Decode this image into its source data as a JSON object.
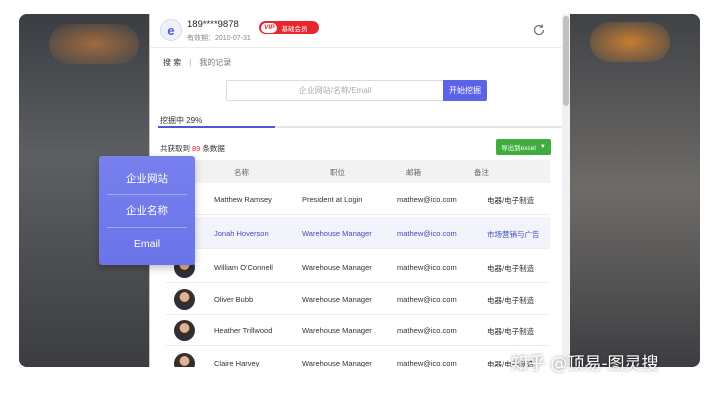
{
  "header": {
    "phone": "189****9878",
    "expiry": "有效期：2010-07-31",
    "vip_tag": "VIP",
    "vip_label": "基础会员"
  },
  "subnav": {
    "search": "搜 索",
    "separator": "|",
    "records": "我的记录"
  },
  "search": {
    "placeholder": "企业网站/名称/Email",
    "button": "开始挖掘"
  },
  "progress": {
    "label": "挖掘中 29%",
    "fraction": 0.29
  },
  "results": {
    "count_prefix": "共获取到",
    "count": "89",
    "count_suffix": "条数据",
    "export_label": "导出到excel"
  },
  "table": {
    "headers": [
      "名称",
      "职位",
      "邮箱",
      "备注"
    ],
    "rows": [
      {
        "name": "Matthew Ramsey",
        "title": "President at Login",
        "email": "mathew@ico.com",
        "note": "电器/电子制造"
      },
      {
        "name": "Jonah Hoverson",
        "title": "Warehouse Manager",
        "email": "mathew@ico.com",
        "note": "市场营销与广告"
      },
      {
        "name": "William O'Connell",
        "title": "Warehouse Manager",
        "email": "mathew@ico.com",
        "note": "电器/电子制造"
      },
      {
        "name": "Oliver Bubb",
        "title": "Warehouse Manager",
        "email": "mathew@ico.com",
        "note": "电器/电子制造"
      },
      {
        "name": "Heather Trillwood",
        "title": "Warehouse Manager",
        "email": "mathew@ico.com",
        "note": "电器/电子制造"
      },
      {
        "name": "Claire Harvey",
        "title": "Warehouse Manager",
        "email": "mathew@ico.com",
        "note": "电器/电子制造"
      }
    ]
  },
  "popup": {
    "items": [
      "企业网站",
      "企业名称",
      "Email"
    ]
  },
  "watermark": "知乎 @顶易-图灵搜",
  "colors": {
    "accent": "#5b64e6",
    "vip": "#e8262d",
    "export": "#3fae3f",
    "highlight_text": "#3f4ab8"
  }
}
